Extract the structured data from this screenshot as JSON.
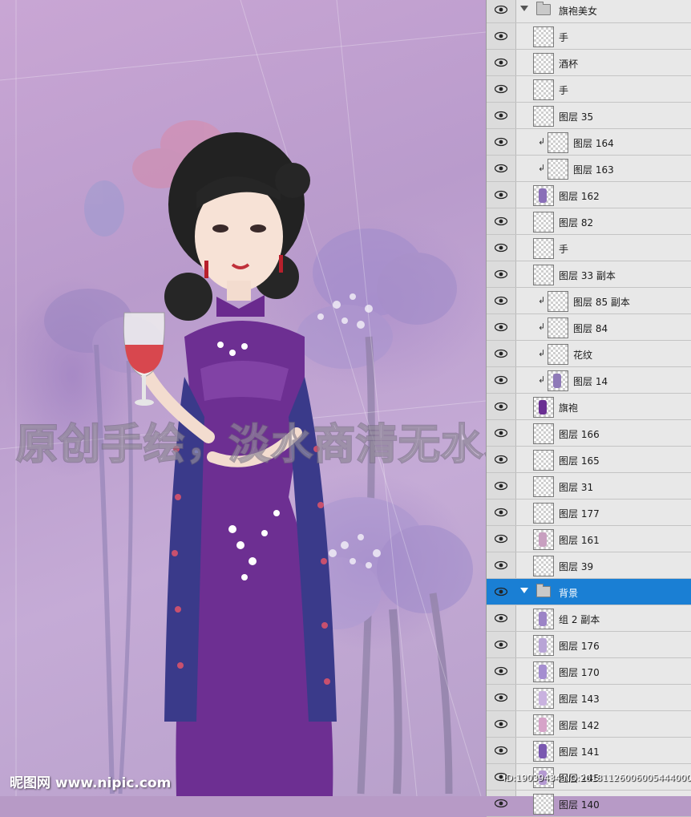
{
  "watermark": {
    "text": "原创手绘，淡水商清无水印，请放心下载。",
    "site": "昵图网 www.nipic.com",
    "id_line": "ID:19039434 NO:20181126006005444000"
  },
  "layers_panel": {
    "accent_color": "#1a7fd4",
    "rows": [
      {
        "name": "旗袍美女",
        "kind": "group",
        "indent": 0
      },
      {
        "name": "手",
        "kind": "layer",
        "indent": 1
      },
      {
        "name": "酒杯",
        "kind": "layer",
        "indent": 1
      },
      {
        "name": "手",
        "kind": "layer",
        "indent": 1
      },
      {
        "name": "图层 35",
        "kind": "layer",
        "indent": 1
      },
      {
        "name": "图层 164",
        "kind": "clipped",
        "indent": 2
      },
      {
        "name": "图层 163",
        "kind": "clipped",
        "indent": 2
      },
      {
        "name": "图层 162",
        "kind": "layer",
        "indent": 1
      },
      {
        "name": "图层 82",
        "kind": "layer",
        "indent": 1
      },
      {
        "name": "手",
        "kind": "layer",
        "indent": 1
      },
      {
        "name": "图层 33 副本",
        "kind": "layer",
        "indent": 1
      },
      {
        "name": "图层 85 副本",
        "kind": "clipped",
        "indent": 2
      },
      {
        "name": "图层 84",
        "kind": "clipped",
        "indent": 2
      },
      {
        "name": "花纹",
        "kind": "clipped",
        "indent": 2
      },
      {
        "name": "图层 14",
        "kind": "clipped",
        "indent": 2
      },
      {
        "name": "旗袍",
        "kind": "layer",
        "indent": 1
      },
      {
        "name": "图层 166",
        "kind": "layer",
        "indent": 1
      },
      {
        "name": "图层 165",
        "kind": "layer",
        "indent": 1
      },
      {
        "name": "图层 31",
        "kind": "layer",
        "indent": 1
      },
      {
        "name": "图层 177",
        "kind": "layer",
        "indent": 1
      },
      {
        "name": "图层 161",
        "kind": "layer",
        "indent": 1
      },
      {
        "name": "图层 39",
        "kind": "layer",
        "indent": 1
      },
      {
        "name": "背景",
        "kind": "group",
        "indent": 0,
        "selected": true
      },
      {
        "name": "组 2 副本",
        "kind": "layer",
        "indent": 1
      },
      {
        "name": "图层 176",
        "kind": "layer",
        "indent": 1
      },
      {
        "name": "图层 170",
        "kind": "layer",
        "indent": 1
      },
      {
        "name": "图层 143",
        "kind": "layer",
        "indent": 1
      },
      {
        "name": "图层 142",
        "kind": "layer",
        "indent": 1
      },
      {
        "name": "图层 141",
        "kind": "layer",
        "indent": 1
      },
      {
        "name": "图层 145",
        "kind": "layer",
        "indent": 1
      },
      {
        "name": "图层 140",
        "kind": "layer",
        "indent": 1
      }
    ]
  }
}
